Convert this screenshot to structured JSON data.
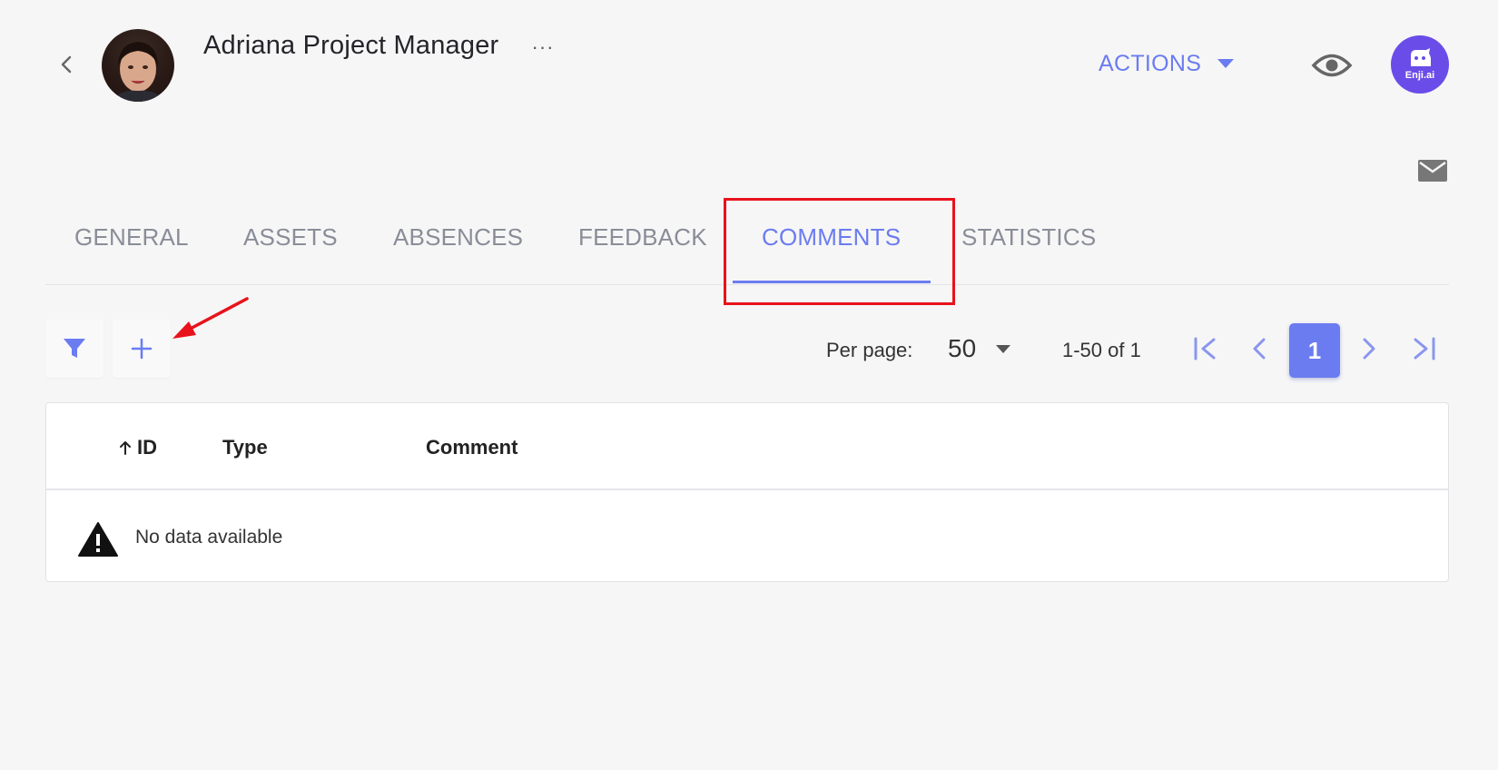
{
  "header": {
    "user_name": "Adriana Project Manager",
    "more_label": "···",
    "actions_label": "ACTIONS",
    "brand_label": "Enji.ai"
  },
  "tabs": [
    {
      "label": "GENERAL",
      "active": false
    },
    {
      "label": "ASSETS",
      "active": false
    },
    {
      "label": "ABSENCES",
      "active": false
    },
    {
      "label": "FEEDBACK",
      "active": false
    },
    {
      "label": "COMMENTS",
      "active": true
    },
    {
      "label": "STATISTICS",
      "active": false
    }
  ],
  "toolbar": {
    "filter_icon": "filter-icon",
    "add_icon": "plus-icon"
  },
  "pagination": {
    "per_page_label": "Per page:",
    "per_page_value": "50",
    "range_text": "1-50 of 1",
    "current_page": "1"
  },
  "table": {
    "columns": [
      {
        "label": "ID",
        "sort": "ascending"
      },
      {
        "label": "Type"
      },
      {
        "label": "Comment"
      }
    ],
    "empty_text": "No data available"
  },
  "colors": {
    "accent": "#6b7cf0",
    "brand": "#6a4ce8",
    "highlight": "#e8121c"
  }
}
